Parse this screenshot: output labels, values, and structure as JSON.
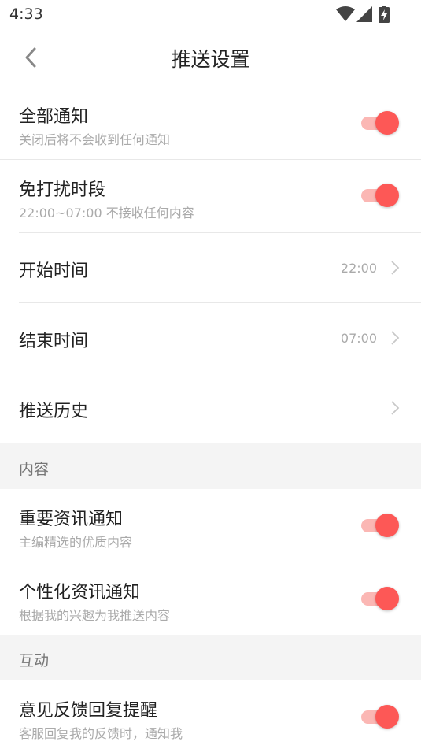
{
  "status_bar": {
    "time": "4:33",
    "icons": [
      "wifi-icon",
      "signal-icon",
      "battery-charging-icon"
    ]
  },
  "header": {
    "title": "推送设置",
    "back_icon": "chevron-left-icon"
  },
  "settings": {
    "all_notifications": {
      "label": "全部通知",
      "desc": "关闭后将不会收到任何通知",
      "enabled": true
    },
    "dnd": {
      "label": "免打扰时段",
      "desc": "22:00~07:00 不接收任何内容",
      "enabled": true
    },
    "start_time": {
      "label": "开始时间",
      "value": "22:00"
    },
    "end_time": {
      "label": "结束时间",
      "value": "07:00"
    },
    "push_history": {
      "label": "推送历史"
    }
  },
  "content_section": {
    "header": "内容",
    "important_news": {
      "label": "重要资讯通知",
      "desc": "主编精选的优质内容",
      "enabled": true
    },
    "personalized_news": {
      "label": "个性化资讯通知",
      "desc": "根据我的兴趣为我推送内容",
      "enabled": true
    }
  },
  "interaction_section": {
    "header": "互动",
    "feedback_reply": {
      "label": "意见反馈回复提醒",
      "desc": "客服回复我的反馈时，通知我",
      "enabled": true
    }
  },
  "colors": {
    "accent": "#fd5856",
    "accent_track": "#fbb7b4",
    "section_bg": "#f4f4f4",
    "secondary_text": "#aaaaaa"
  }
}
